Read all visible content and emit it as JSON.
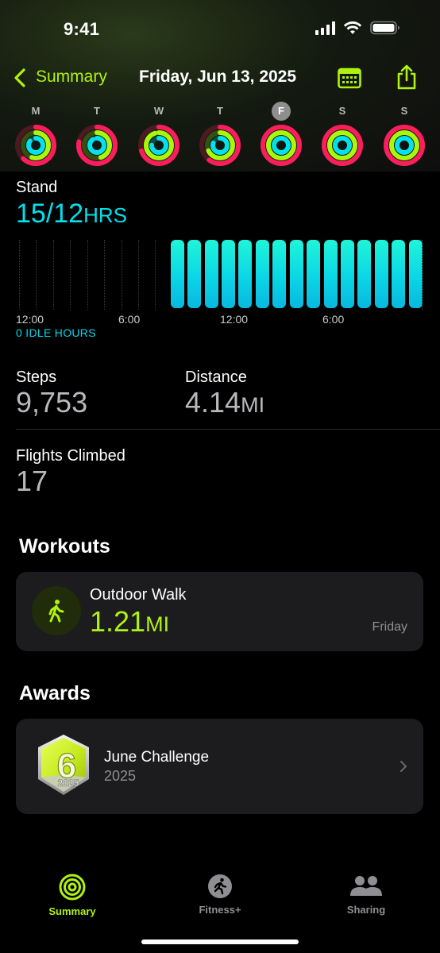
{
  "status_bar": {
    "time": "9:41"
  },
  "nav": {
    "back_label": "Summary",
    "date": "Friday, Jun 13, 2025"
  },
  "week": {
    "days": [
      {
        "letter": "M",
        "move": 0.62,
        "exercise": 0.55,
        "stand": 0.85
      },
      {
        "letter": "T",
        "move": 0.78,
        "exercise": 0.45,
        "stand": 0.9
      },
      {
        "letter": "W",
        "move": 0.7,
        "exercise": 0.95,
        "stand": 0.75
      },
      {
        "letter": "T",
        "move": 0.6,
        "exercise": 0.68,
        "stand": 0.8
      },
      {
        "letter": "F",
        "move": 1.0,
        "exercise": 1.0,
        "stand": 1.0,
        "selected": true
      },
      {
        "letter": "S",
        "move": 1.0,
        "exercise": 1.0,
        "stand": 1.0
      },
      {
        "letter": "S",
        "move": 1.0,
        "exercise": 1.0,
        "stand": 1.0
      }
    ]
  },
  "stand": {
    "label": "Stand",
    "value": "15/12",
    "unit": "HRS",
    "idle": "0 IDLE HOURS",
    "ticks": [
      "12:00",
      "6:00",
      "12:00",
      "6:00"
    ],
    "hours_stood": [
      0,
      0,
      0,
      0,
      0,
      0,
      0,
      0,
      0,
      1,
      1,
      1,
      1,
      1,
      1,
      1,
      1,
      1,
      1,
      1,
      1,
      1,
      1,
      1
    ]
  },
  "steps": {
    "label": "Steps",
    "value": "9,753"
  },
  "distance": {
    "label": "Distance",
    "value": "4.14",
    "unit": "MI"
  },
  "flights": {
    "label": "Flights Climbed",
    "value": "17"
  },
  "workouts": {
    "title": "Workouts",
    "item": {
      "name": "Outdoor Walk",
      "value": "1.21",
      "unit": "MI",
      "day": "Friday",
      "icon": "walk-icon"
    }
  },
  "awards": {
    "title": "Awards",
    "item": {
      "name": "June Challenge",
      "year": "2025",
      "badge_number": "6",
      "badge_year": "2025"
    }
  },
  "tabs": [
    {
      "label": "Summary",
      "icon": "rings-icon",
      "active": true
    },
    {
      "label": "Fitness+",
      "icon": "runner-icon",
      "active": false
    },
    {
      "label": "Sharing",
      "icon": "people-icon",
      "active": false
    }
  ],
  "colors": {
    "accent": "#b0f20f",
    "move": "#fa1e5c",
    "exercise": "#a9f70a",
    "stand": "#00e0ed",
    "inactive_text": "#8f8f93"
  }
}
